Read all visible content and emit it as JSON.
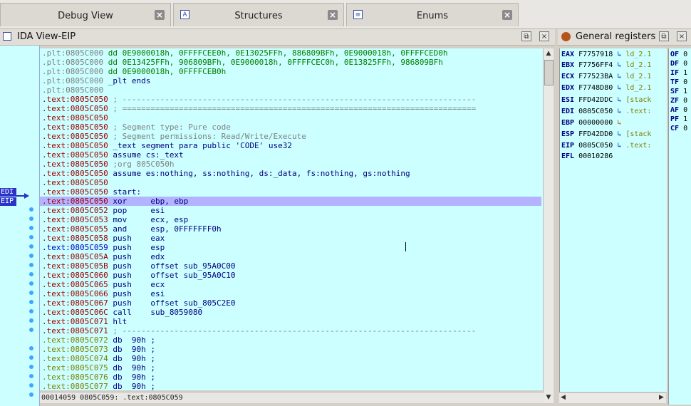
{
  "tabs": [
    {
      "label": "Debug View"
    },
    {
      "label": "Structures",
      "icon": "A"
    },
    {
      "label": "Enums",
      "icon": "≡"
    }
  ],
  "panels": {
    "ida_view_title": "IDA View-EIP",
    "registers_title": "General registers"
  },
  "gutter_labels": {
    "edi": "EDI",
    "eip": "EIP"
  },
  "disasm_lines": [
    {
      "seg": "plt",
      "addr": ".plt:0805C000",
      "code": "dd 0E9000018h, 0FFFFCEE0h, 0E13025FFh, 886809BFh, 0E9000018h, 0FFFFCED0h",
      "cls": "num"
    },
    {
      "seg": "plt",
      "addr": ".plt:0805C000",
      "code": "dd 0E13425FFh, 906809BFh, 0E9000018h, 0FFFFCEC0h, 0E13825FFh, 986809BFh",
      "cls": "num"
    },
    {
      "seg": "plt",
      "addr": ".plt:0805C000",
      "code": "dd 0E9000018h, 0FFFFCEB0h",
      "cls": "num"
    },
    {
      "seg": "plt",
      "addr": ".plt:0805C000",
      "code": "_plt ends",
      "cls": "kw"
    },
    {
      "seg": "plt",
      "addr": ".plt:0805C000",
      "code": "",
      "cls": "kw"
    },
    {
      "seg": "txt",
      "addr": ".text:0805C050",
      "code": "; ---------------------------------------------------------------------------",
      "cls": "cmt"
    },
    {
      "seg": "txt",
      "addr": ".text:0805C050",
      "code": "; ===========================================================================",
      "cls": "cmt"
    },
    {
      "seg": "txt",
      "addr": ".text:0805C050",
      "code": "",
      "cls": "kw"
    },
    {
      "seg": "txt",
      "addr": ".text:0805C050",
      "code": "; Segment type: Pure code",
      "cls": "cmt"
    },
    {
      "seg": "txt",
      "addr": ".text:0805C050",
      "code": "; Segment permissions: Read/Write/Execute",
      "cls": "cmt"
    },
    {
      "seg": "txt",
      "addr": ".text:0805C050",
      "code": "_text segment para public 'CODE' use32",
      "cls": "kw"
    },
    {
      "seg": "txt",
      "addr": ".text:0805C050",
      "code": "assume cs:_text",
      "cls": "kw"
    },
    {
      "seg": "txt",
      "addr": ".text:0805C050",
      "code": ";org 805C050h",
      "cls": "cmt"
    },
    {
      "seg": "txt",
      "addr": ".text:0805C050",
      "code": "assume es:nothing, ss:nothing, ds:_data, fs:nothing, gs:nothing",
      "cls": "kw"
    },
    {
      "seg": "txt",
      "addr": ".text:0805C050",
      "code": "",
      "cls": "kw"
    },
    {
      "seg": "txt",
      "addr": ".text:0805C050",
      "code": "start:",
      "cls": "kw"
    },
    {
      "seg": "txt",
      "addr": ".text:0805C050",
      "code": "xor     ebp, ebp",
      "cls": "kw",
      "hl": true
    },
    {
      "seg": "txt",
      "addr": ".text:0805C052",
      "code": "pop     esi",
      "cls": "kw"
    },
    {
      "seg": "txt",
      "addr": ".text:0805C053",
      "code": "mov     ecx, esp",
      "cls": "kw"
    },
    {
      "seg": "txt",
      "addr": ".text:0805C055",
      "code": "and     esp, 0FFFFFFF0h",
      "cls": "kw"
    },
    {
      "seg": "txt",
      "addr": ".text:0805C058",
      "code": "push    eax",
      "cls": "kw"
    },
    {
      "seg": "txtb",
      "addr": ".text:0805C059",
      "code": "push    esp",
      "cls": "kw"
    },
    {
      "seg": "txt",
      "addr": ".text:0805C05A",
      "code": "push    edx",
      "cls": "kw"
    },
    {
      "seg": "txt",
      "addr": ".text:0805C05B",
      "code": "push    offset sub_95A0C00",
      "cls": "kw"
    },
    {
      "seg": "txt",
      "addr": ".text:0805C060",
      "code": "push    offset sub_95A0C10",
      "cls": "kw"
    },
    {
      "seg": "txt",
      "addr": ".text:0805C065",
      "code": "push    ecx",
      "cls": "kw"
    },
    {
      "seg": "txt",
      "addr": ".text:0805C066",
      "code": "push    esi",
      "cls": "kw"
    },
    {
      "seg": "txt",
      "addr": ".text:0805C067",
      "code": "push    offset sub_805C2E0",
      "cls": "kw"
    },
    {
      "seg": "txt",
      "addr": ".text:0805C06C",
      "code": "call    sub_8059080",
      "cls": "kw"
    },
    {
      "seg": "txt",
      "addr": ".text:0805C071",
      "code": "hlt",
      "cls": "kw"
    },
    {
      "seg": "txt",
      "addr": ".text:0805C071",
      "code": "; ---------------------------------------------------------------------------",
      "cls": "cmt"
    },
    {
      "seg": "dat",
      "addr": ".text:0805C072",
      "code": "db  90h ;",
      "cls": "kw"
    },
    {
      "seg": "dat",
      "addr": ".text:0805C073",
      "code": "db  90h ;",
      "cls": "kw"
    },
    {
      "seg": "dat",
      "addr": ".text:0805C074",
      "code": "db  90h ;",
      "cls": "kw"
    },
    {
      "seg": "dat",
      "addr": ".text:0805C075",
      "code": "db  90h ;",
      "cls": "kw"
    },
    {
      "seg": "dat",
      "addr": ".text:0805C076",
      "code": "db  90h ;",
      "cls": "kw"
    },
    {
      "seg": "dat",
      "addr": ".text:0805C077",
      "code": "db  90h ;",
      "cls": "kw"
    }
  ],
  "status_line": "00014059 0805C059: .text:0805C059",
  "registers": [
    {
      "name": "EAX",
      "value": "F7757918",
      "arrow": "↳",
      "ref": "ld_2.1"
    },
    {
      "name": "EBX",
      "value": "F7756FF4",
      "arrow": "↳",
      "ref": "ld_2.1"
    },
    {
      "name": "ECX",
      "value": "F77523BA",
      "arrow": "↳",
      "ref": "ld_2.1"
    },
    {
      "name": "EDX",
      "value": "F7748D80",
      "arrow": "↳",
      "ref": "ld_2.1"
    },
    {
      "name": "ESI",
      "value": "FFD42DDC",
      "arrow": "↳",
      "ref": "[stack"
    },
    {
      "name": "EDI",
      "value": "0805C050",
      "arrow": "↳",
      "ref": ".text:"
    },
    {
      "name": "EBP",
      "value": "00000000",
      "arrow": "↳",
      "ref": ""
    },
    {
      "name": "ESP",
      "value": "FFD42DD0",
      "arrow": "↳",
      "ref": "[stack"
    },
    {
      "name": "EIP",
      "value": "0805C050",
      "arrow": "↳",
      "ref": ".text:"
    },
    {
      "name": "EFL",
      "value": "00010286",
      "arrow": "",
      "ref": ""
    }
  ],
  "flags": [
    {
      "name": "OF",
      "value": "0"
    },
    {
      "name": "DF",
      "value": "0"
    },
    {
      "name": "IF",
      "value": "1"
    },
    {
      "name": "TF",
      "value": "0"
    },
    {
      "name": "SF",
      "value": "1"
    },
    {
      "name": "ZF",
      "value": "0"
    },
    {
      "name": "AF",
      "value": "0"
    },
    {
      "name": "PF",
      "value": "1"
    },
    {
      "name": "CF",
      "value": "0"
    }
  ]
}
